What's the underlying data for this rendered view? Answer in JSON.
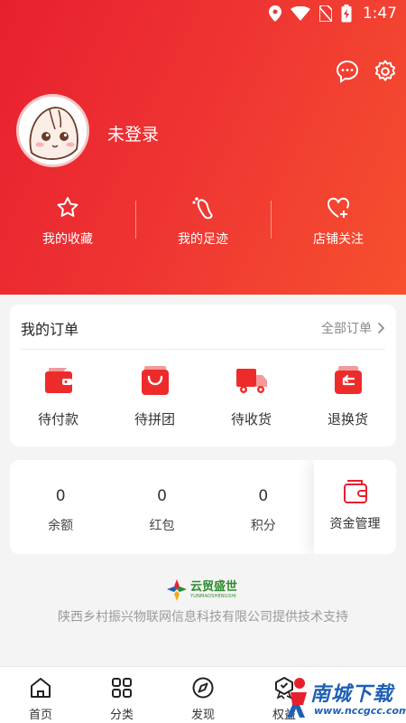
{
  "status_bar": {
    "time": "1:47",
    "icons": [
      "location-icon",
      "wifi-icon",
      "no-sim-icon",
      "battery-charging-icon"
    ]
  },
  "header": {
    "login_text": "未登录",
    "actions": [
      "message-icon",
      "settings-icon"
    ],
    "quick_links": [
      {
        "label": "我的收藏",
        "icon": "star-icon"
      },
      {
        "label": "我的足迹",
        "icon": "footprint-icon"
      },
      {
        "label": "店铺关注",
        "icon": "heart-plus-icon"
      }
    ],
    "colors": {
      "gradient_start": "#e8202e",
      "gradient_end": "#f6502e"
    }
  },
  "orders": {
    "title": "我的订单",
    "all_label": "全部订单",
    "items": [
      {
        "label": "待付款",
        "icon": "wallet-icon"
      },
      {
        "label": "待拼团",
        "icon": "shopping-bag-icon"
      },
      {
        "label": "待收货",
        "icon": "truck-icon"
      },
      {
        "label": "退换货",
        "icon": "return-icon"
      }
    ]
  },
  "assets": {
    "items": [
      {
        "value": "0",
        "label": "余额"
      },
      {
        "value": "0",
        "label": "红包"
      },
      {
        "value": "0",
        "label": "积分"
      }
    ],
    "fund_label": "资金管理"
  },
  "footer": {
    "logo_cn": "云贸盛世",
    "logo_en": "YUNMAOSHENGSHI",
    "support_text": "陕西乡村振兴物联网信息科技有限公司提供技术支持"
  },
  "tabbar": {
    "tabs": [
      {
        "label": "首页",
        "icon": "home-icon"
      },
      {
        "label": "分类",
        "icon": "grid-icon"
      },
      {
        "label": "发现",
        "icon": "compass-icon"
      },
      {
        "label": "权益",
        "icon": "badge-icon"
      }
    ]
  },
  "watermark": {
    "cn": "南城下载",
    "url": "www.nccgcc.com"
  }
}
